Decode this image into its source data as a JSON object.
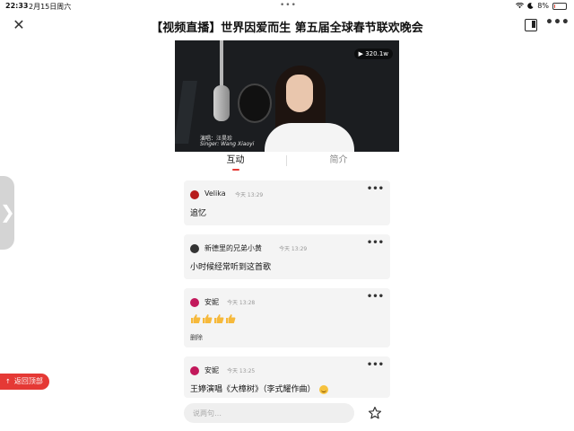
{
  "status_bar": {
    "time": "22:33",
    "date": "2月15日周六",
    "dots": "•••",
    "battery": "8%",
    "battery_level": 0.08,
    "battery_color": "#e0402f"
  },
  "nav": {
    "close_icon": "close-icon",
    "title": "【视频直播】世界因爱而生 第五届全球春节联欢晚会",
    "window_icon": "window-icon",
    "more": "•••"
  },
  "video": {
    "views": "▶ 320.1w",
    "caption_line1": "演唱：汪昊珍",
    "caption_line2": "Singer: Wang Xiaoyi"
  },
  "tabs": [
    {
      "label": "互动",
      "active": true
    },
    {
      "label": "简介",
      "active": false
    }
  ],
  "comments": [
    {
      "user": "Velika",
      "time": "今天 13:29",
      "text": "追忆",
      "more": "•••"
    },
    {
      "user": "新德里的兄弟小黄",
      "time": "今天 13:29",
      "text": "小时候经常听到这首歌",
      "more": "•••"
    },
    {
      "user": "安妮",
      "time": "今天 13:28",
      "emoji": "👍👍👍👍",
      "delete_label": "删除",
      "more": "•••"
    },
    {
      "user": "安妮",
      "time": "今天 13:25",
      "text": "王婷演唱《大樟树》（李式耀作曲）",
      "more": "•••"
    }
  ],
  "side_handle": "❯",
  "back_to_top": "返回顶部",
  "input": {
    "placeholder": "说两句…"
  },
  "accent_color": "#e53935"
}
